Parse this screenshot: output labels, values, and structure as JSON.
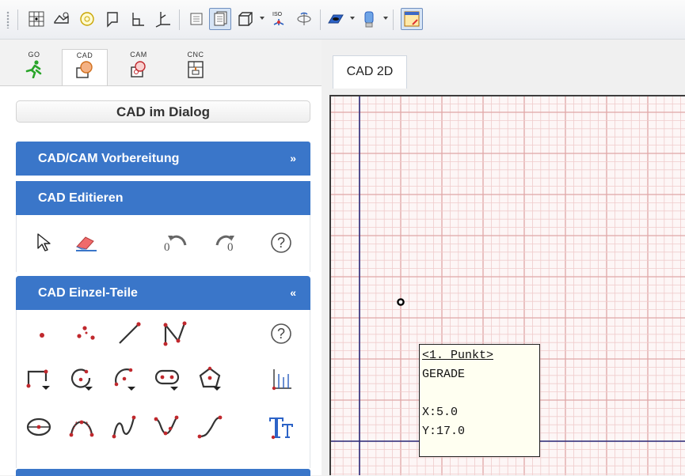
{
  "left_tabs": [
    {
      "label": "GO",
      "icon": "runner-icon"
    },
    {
      "label": "CAD",
      "icon": "cad-shapes-icon"
    },
    {
      "label": "CAM",
      "icon": "cam-icon"
    },
    {
      "label": "CNC",
      "icon": "cnc-machine-icon"
    }
  ],
  "dialog_button": "CAD im Dialog",
  "sections": {
    "vorbereitung": {
      "title": "CAD/CAM Vorbereitung",
      "chevron": "»"
    },
    "editieren": {
      "title": "CAD Editieren"
    },
    "einzelteile": {
      "title": "CAD Einzel-Teile",
      "chevron": "«"
    }
  },
  "edit_tools": {
    "undo_count": "0",
    "redo_count": "0",
    "help": "?"
  },
  "einzel_help": "?",
  "canvas_tab": "CAD 2D",
  "tooltip": {
    "line1": "<1. Punkt>",
    "line2": "GERADE",
    "line3": "X:5.0",
    "line4": "Y:17.0"
  },
  "colors": {
    "header_blue": "#3a76c9",
    "grid_major": "#e0a7a7",
    "grid_minor": "#f0cccc",
    "axis": "#2a2a7a",
    "tool_red": "#c0282d"
  }
}
